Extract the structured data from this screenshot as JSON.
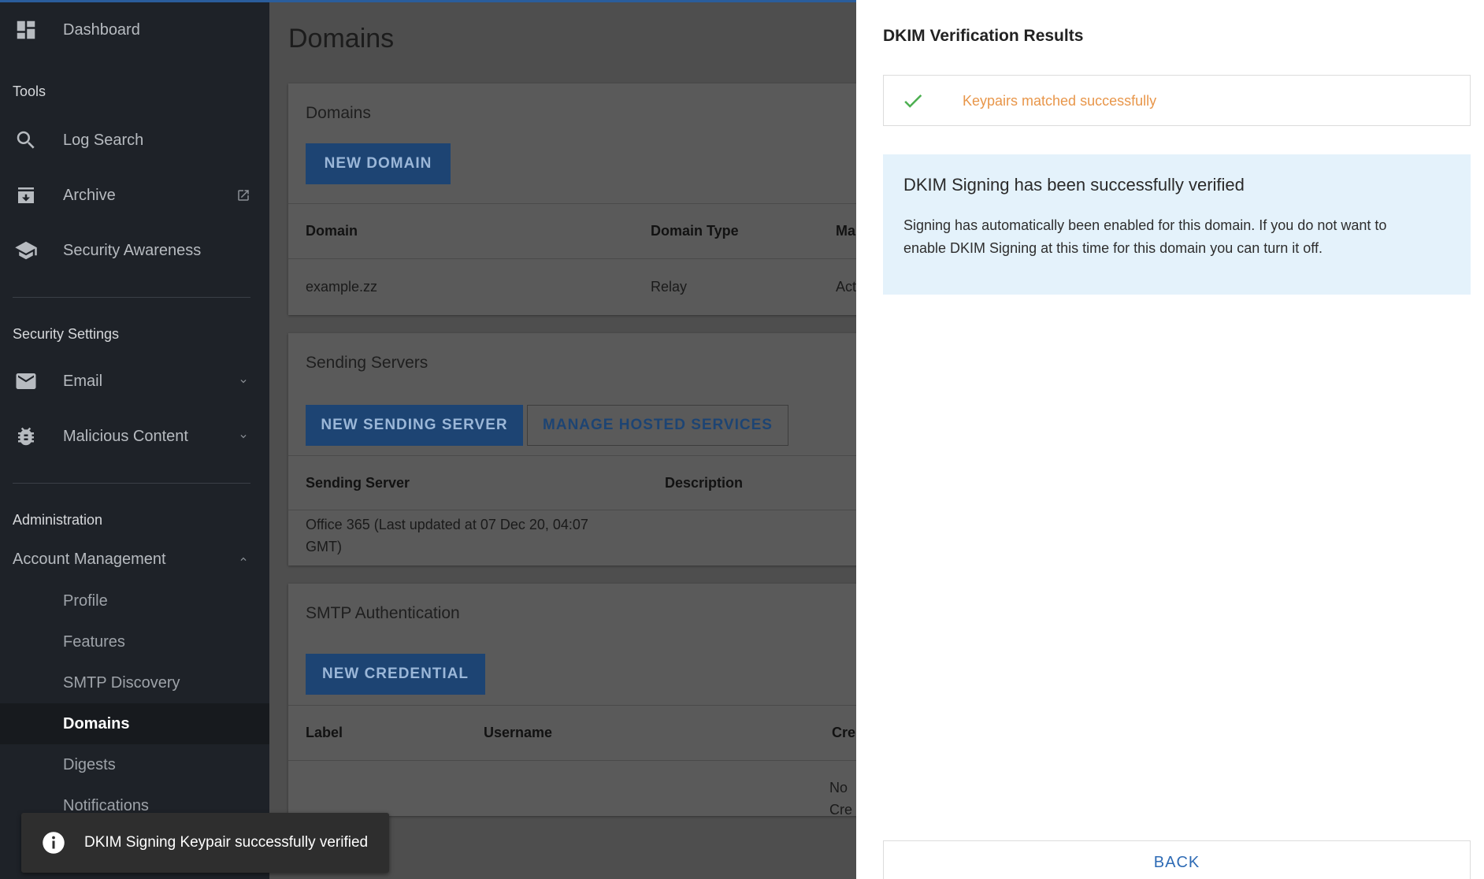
{
  "sidebar": {
    "dashboard": "Dashboard",
    "tools_title": "Tools",
    "log_search": "Log Search",
    "archive": "Archive",
    "security_awareness": "Security Awareness",
    "security_settings_title": "Security Settings",
    "email": "Email",
    "malicious_content": "Malicious Content",
    "administration_title": "Administration",
    "account_management": "Account Management",
    "sub_items": [
      "Profile",
      "Features",
      "SMTP Discovery",
      "Domains",
      "Digests",
      "Notifications"
    ],
    "active_item": "Domains"
  },
  "main": {
    "page_title": "Domains",
    "domains_card": {
      "title": "Domains",
      "new_button": "NEW DOMAIN",
      "headers": [
        "Domain",
        "Domain Type",
        "Ma"
      ],
      "row": [
        "example.zz",
        "Relay",
        "Act"
      ]
    },
    "servers_card": {
      "title": "Sending Servers",
      "new_button": "NEW SENDING SERVER",
      "manage_button": "MANAGE HOSTED SERVICES",
      "headers": [
        "Sending Server",
        "Description"
      ],
      "row_line1": "Office 365 (Last updated at 07 Dec 20, 04:07",
      "row_line2": "GMT)"
    },
    "smtp_card": {
      "title": "SMTP Authentication",
      "new_button": "NEW CREDENTIAL",
      "headers": [
        "Label",
        "Username",
        "Cre"
      ],
      "empty_text": "No Cre"
    }
  },
  "snackbar": {
    "text": "DKIM Signing Keypair successfully verified"
  },
  "panel": {
    "title": "DKIM Verification Results",
    "result_text": "Keypairs matched successfully",
    "alert_heading": "DKIM Signing has been successfully verified",
    "alert_line1": "Signing has automatically been enabled for this domain. If you do not want to",
    "alert_line2": "enable DKIM Signing at this time for this domain you can turn it off.",
    "back_button": "BACK"
  },
  "colors": {
    "primary": "#1d4473",
    "success_check": "#4caf50",
    "result_text": "#e8964a",
    "alert_bg": "#e4f2fb",
    "link": "#2e6bb5"
  }
}
